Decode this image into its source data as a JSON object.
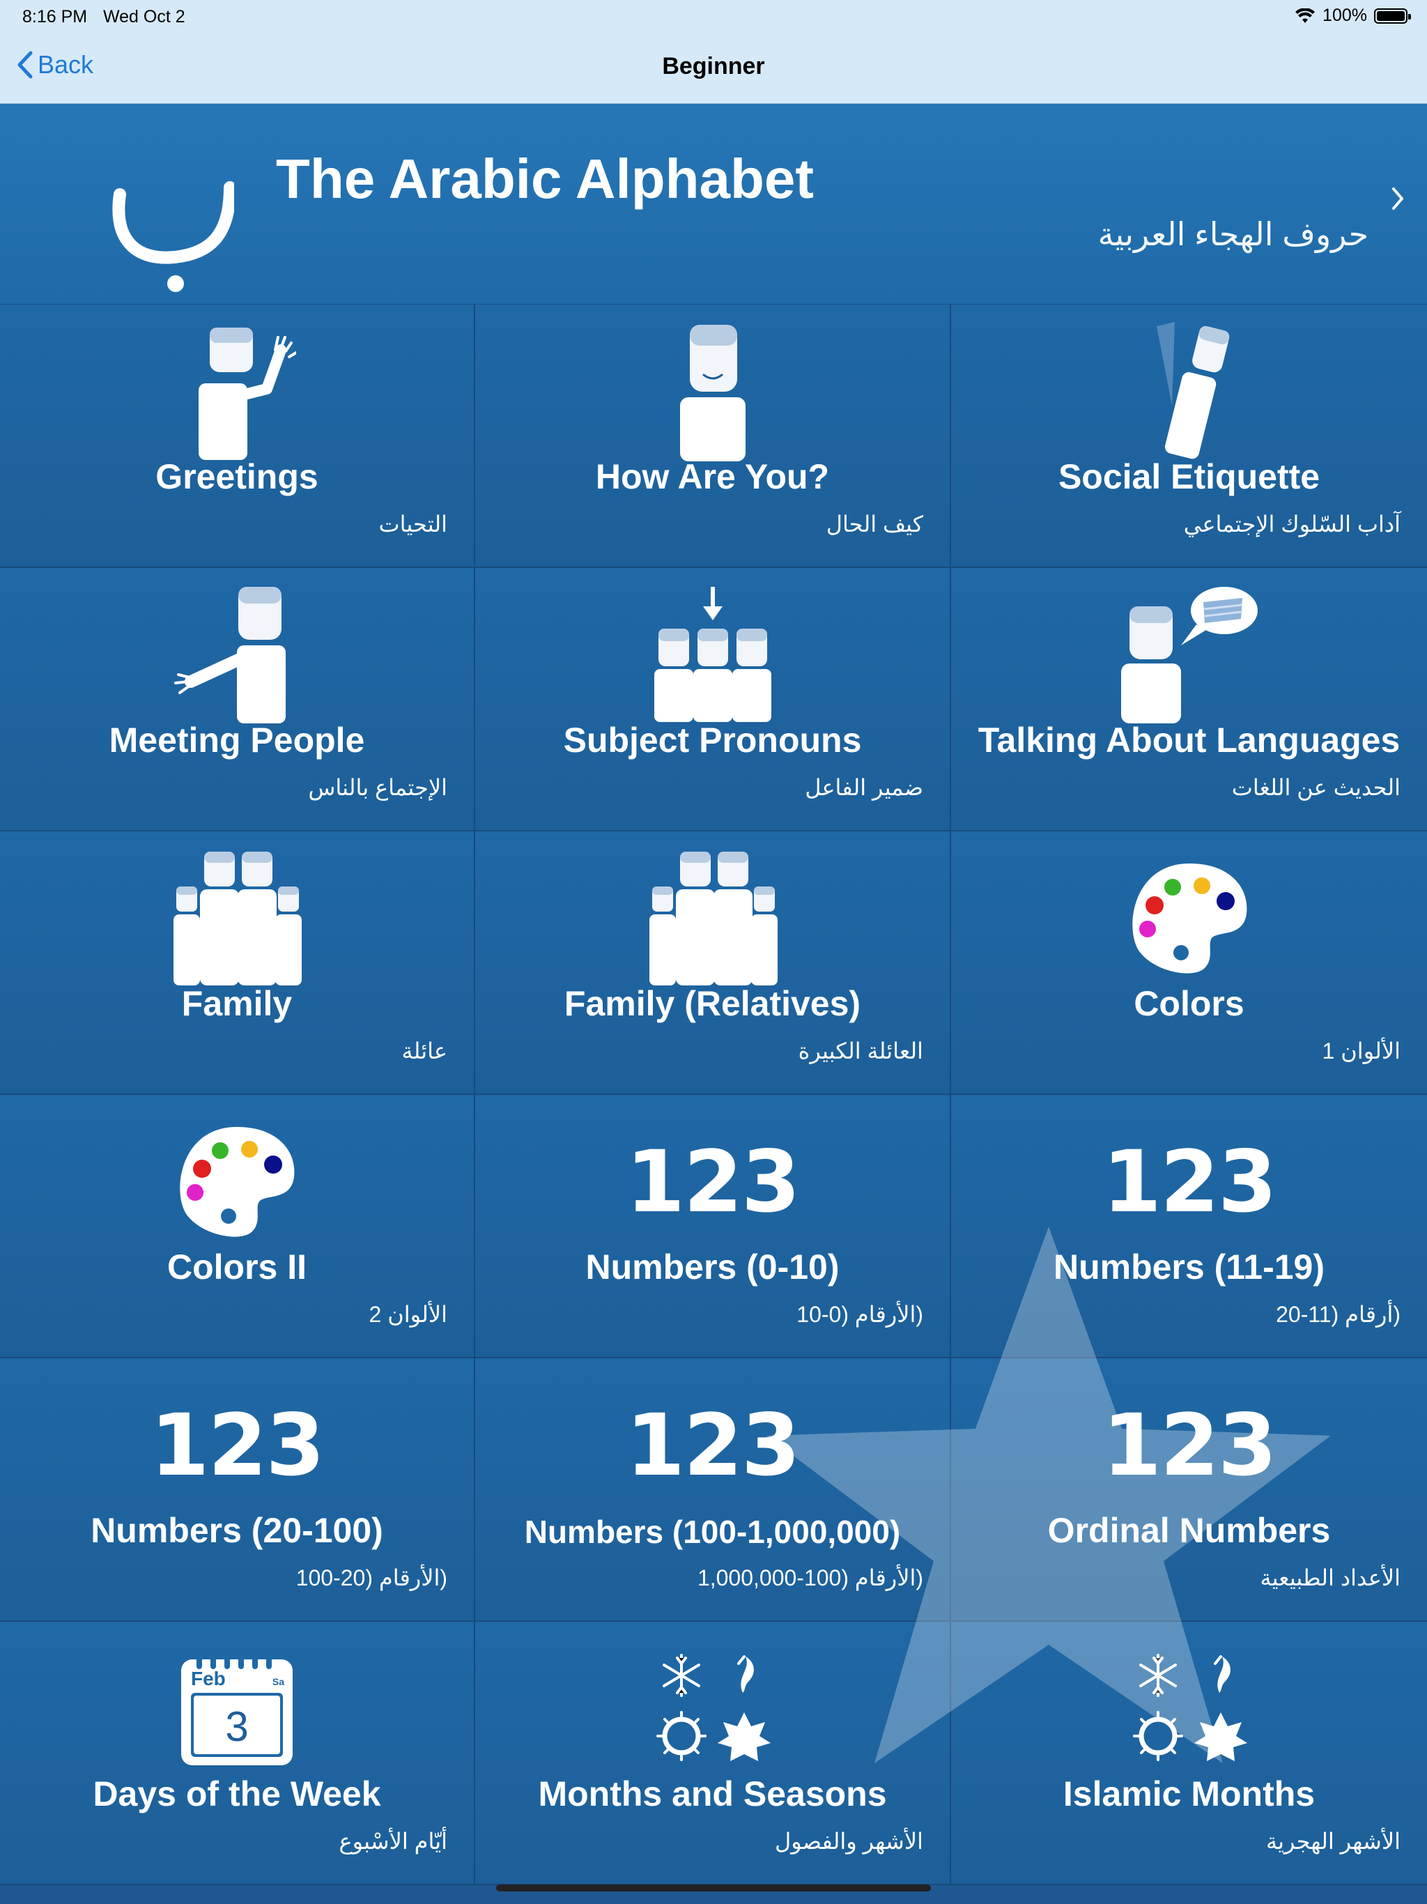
{
  "status_bar": {
    "time": "8:16 PM",
    "date": "Wed Oct 2",
    "battery": "100%"
  },
  "nav": {
    "back_label": "Back",
    "title": "Beginner"
  },
  "banner": {
    "glyph": "ب",
    "title": "The Arabic Alphabet",
    "subtitle": "حروف الهجاء العربية"
  },
  "lessons": [
    {
      "label": "Greetings",
      "arabic": "التحيات",
      "icon": "person-waving-icon"
    },
    {
      "label": "How Are You?",
      "arabic": "كيف الحال",
      "icon": "person-smiling-icon"
    },
    {
      "label": "Social Etiquette",
      "arabic": "آداب السّلوك الإجتماعي",
      "icon": "person-bowing-icon"
    },
    {
      "label": "Meeting People",
      "arabic": "الإجتماع بالناس",
      "icon": "person-handshake-icon"
    },
    {
      "label": "Subject Pronouns",
      "arabic": "ضمير الفاعل",
      "icon": "pronouns-group-icon"
    },
    {
      "label": "Talking About Languages",
      "arabic": "الحديث عن اللغات",
      "icon": "speech-flag-icon"
    },
    {
      "label": "Family",
      "arabic": "عائلة",
      "icon": "family-icon"
    },
    {
      "label": "Family (Relatives)",
      "arabic": "العائلة الكبيرة",
      "icon": "relatives-icon"
    },
    {
      "label": "Colors",
      "arabic": "الألوان 1",
      "icon": "palette-icon"
    },
    {
      "label": "Colors II",
      "arabic": "الألوان 2",
      "icon": "palette-icon"
    },
    {
      "label": "Numbers (0-10)",
      "arabic": "(الأرقام (0-10",
      "icon": "numbers-icon",
      "icon_text": "123"
    },
    {
      "label": "Numbers (11-19)",
      "arabic": "(أرقام (11-20",
      "icon": "numbers-icon",
      "icon_text": "123"
    },
    {
      "label": "Numbers (20-100)",
      "arabic": "(الأرقام (20-100",
      "icon": "numbers-icon",
      "icon_text": "123"
    },
    {
      "label": "Numbers (100-1,000,000)",
      "arabic": "(الأرقام (100-1,000,000",
      "icon": "numbers-icon",
      "icon_text": "123"
    },
    {
      "label": "Ordinal Numbers",
      "arabic": "الأعداد الطبيعية",
      "icon": "numbers-icon",
      "icon_text": "123"
    },
    {
      "label": "Days of the Week",
      "arabic": "أيّام الأسْبوع",
      "icon": "calendar-icon",
      "calendar": {
        "month": "Feb",
        "weekday": "Sa",
        "day": "3"
      }
    },
    {
      "label": "Months and Seasons",
      "arabic": "الأشهر والفصول",
      "icon": "seasons-icon"
    },
    {
      "label": "Islamic Months",
      "arabic": "الأشهر الهجرية",
      "icon": "seasons-icon"
    }
  ],
  "colors": {
    "banner_bg": "#2676b6",
    "tile_bg": "#1f68a6",
    "nav_bg": "#d6e9f8",
    "link": "#1e7bd6"
  }
}
